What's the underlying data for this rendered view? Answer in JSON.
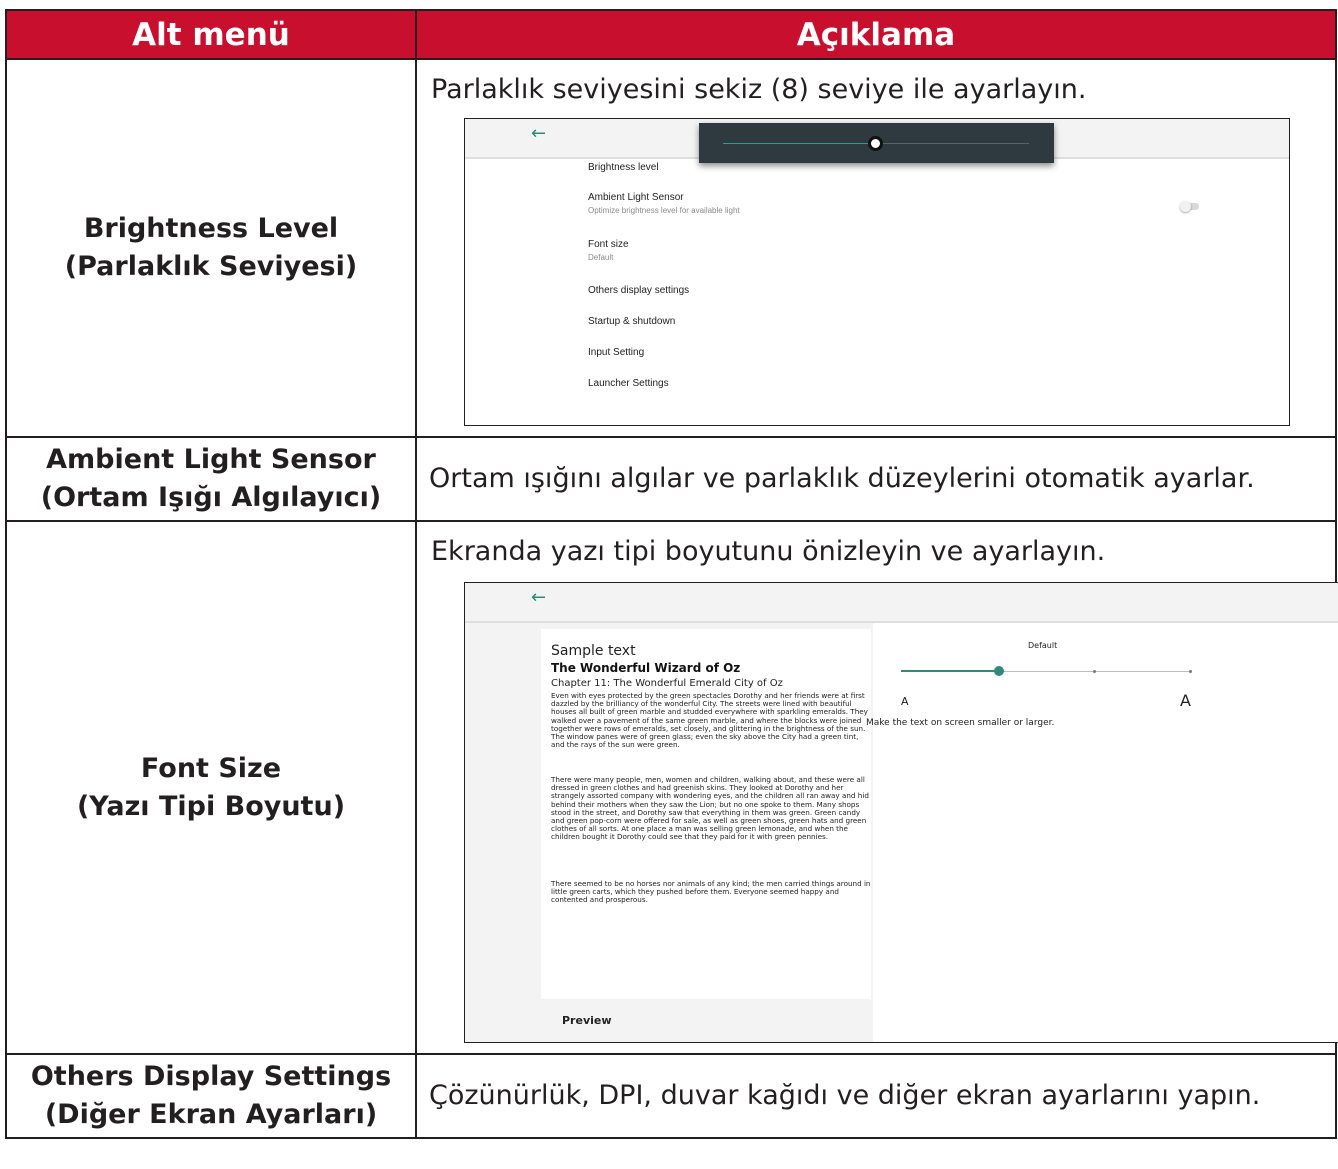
{
  "header": {
    "col1": "Alt menü",
    "col2": "Açıklama"
  },
  "rows": [
    {
      "title_en": "Brightness Level",
      "title_tr": "(Parlaklık Seviyesi)",
      "desc": "Parlaklık seviyesini sekiz (8) seviye ile ayarlayın."
    },
    {
      "title_en": "Ambient Light Sensor",
      "title_tr": "(Ortam Işığı Algılayıcı)",
      "desc": "Ortam ışığını algılar ve parlaklık düzeylerini otomatik ayarlar."
    },
    {
      "title_en": "Font Size",
      "title_tr": "(Yazı Tipi Boyutu)",
      "desc": "Ekranda yazı tipi boyutunu önizleyin ve ayarlayın."
    },
    {
      "title_en": "Others Display Settings",
      "title_tr": "(Diğer Ekran Ayarları)",
      "desc": "Çözünürlük, DPI, duvar kağıdı ve diğer ekran ayarlarını yapın."
    }
  ],
  "screenshot1": {
    "back_icon": "←",
    "slider_value": 0.5,
    "items": [
      {
        "label": "Brightness level"
      },
      {
        "label": "Ambient Light Sensor",
        "sub": "Optimize brightness level for available light"
      },
      {
        "label": "Font size",
        "sub": "Default"
      },
      {
        "label": "Others display settings"
      },
      {
        "label": "Startup & shutdown"
      },
      {
        "label": "Input Setting"
      },
      {
        "label": "Launcher Settings"
      }
    ],
    "ambient_toggle_on": false
  },
  "screenshot2": {
    "back_icon": "←",
    "sample_title": "Sample text",
    "book_title": "The Wonderful Wizard of Oz",
    "chapter": "Chapter 11: The Wonderful Emerald City of Oz",
    "para1": "Even with eyes protected by the green spectacles Dorothy and her friends were at first dazzled by the brilliancy of the wonderful City. The streets were lined with beautiful houses all built of green marble and studded everywhere with sparkling emeralds. They walked over a pavement of the same green marble, and where the blocks were joined together were rows of emeralds, set closely, and glittering in the brightness of the sun. The window panes were of green glass; even the sky above the City had a green tint, and the rays of the sun were green.",
    "para2": "There were many people, men, women and children, walking about, and these were all dressed in green clothes and had greenish skins. They looked at Dorothy and her strangely assorted company with wondering eyes, and the children all ran away and hid behind their mothers when they saw the Lion; but no one spoke to them. Many shops stood in the street, and Dorothy saw that everything in them was green. Green candy and green pop-corn were offered for sale, as well as green shoes, green hats and green clothes of all sorts. At one place a man was selling green lemonade, and when the children bought it Dorothy could see that they paid for it with green pennies.",
    "para3": "There seemed to be no horses nor animals of any kind; the men carried things around in little green carts, which they pushed before them. Everyone seemed happy and contented and prosperous.",
    "preview_label": "Preview",
    "size_label": "Default",
    "size_step": 2,
    "size_steps_total": 4,
    "a_small": "A",
    "a_large": "A",
    "size_desc": "Make the text on screen smaller or larger."
  },
  "colors": {
    "header_bg": "#c8102e",
    "accent": "#2e8b7a"
  }
}
